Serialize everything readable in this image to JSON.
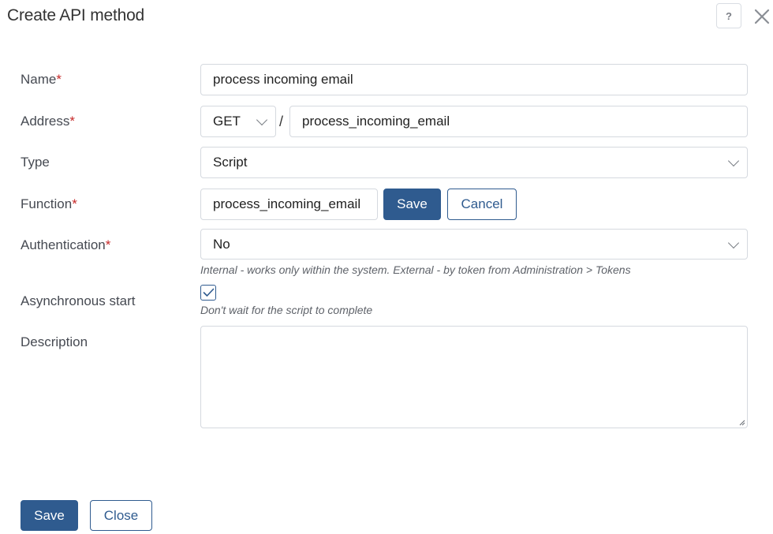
{
  "dialog": {
    "title": "Create API method",
    "help_label": "?"
  },
  "form": {
    "name": {
      "label": "Name",
      "required_mark": "*",
      "value": "process incoming email"
    },
    "address": {
      "label": "Address",
      "required_mark": "*",
      "method": "GET",
      "separator": "/",
      "path": "process_incoming_email"
    },
    "type": {
      "label": "Type",
      "value": "Script"
    },
    "function": {
      "label": "Function",
      "required_mark": "*",
      "value": "process_incoming_email",
      "save_label": "Save",
      "cancel_label": "Cancel"
    },
    "authentication": {
      "label": "Authentication",
      "required_mark": "*",
      "value": "No",
      "hint": "Internal - works only within the system. External - by token from Administration > Tokens"
    },
    "async": {
      "label": "Asynchronous start",
      "checked": true,
      "hint": "Don't wait for the script to complete"
    },
    "description": {
      "label": "Description",
      "value": ""
    }
  },
  "footer": {
    "save_label": "Save",
    "close_label": "Close"
  },
  "colors": {
    "primary": "#2f5b8f",
    "required": "#c62828",
    "border": "#d5d9df"
  }
}
